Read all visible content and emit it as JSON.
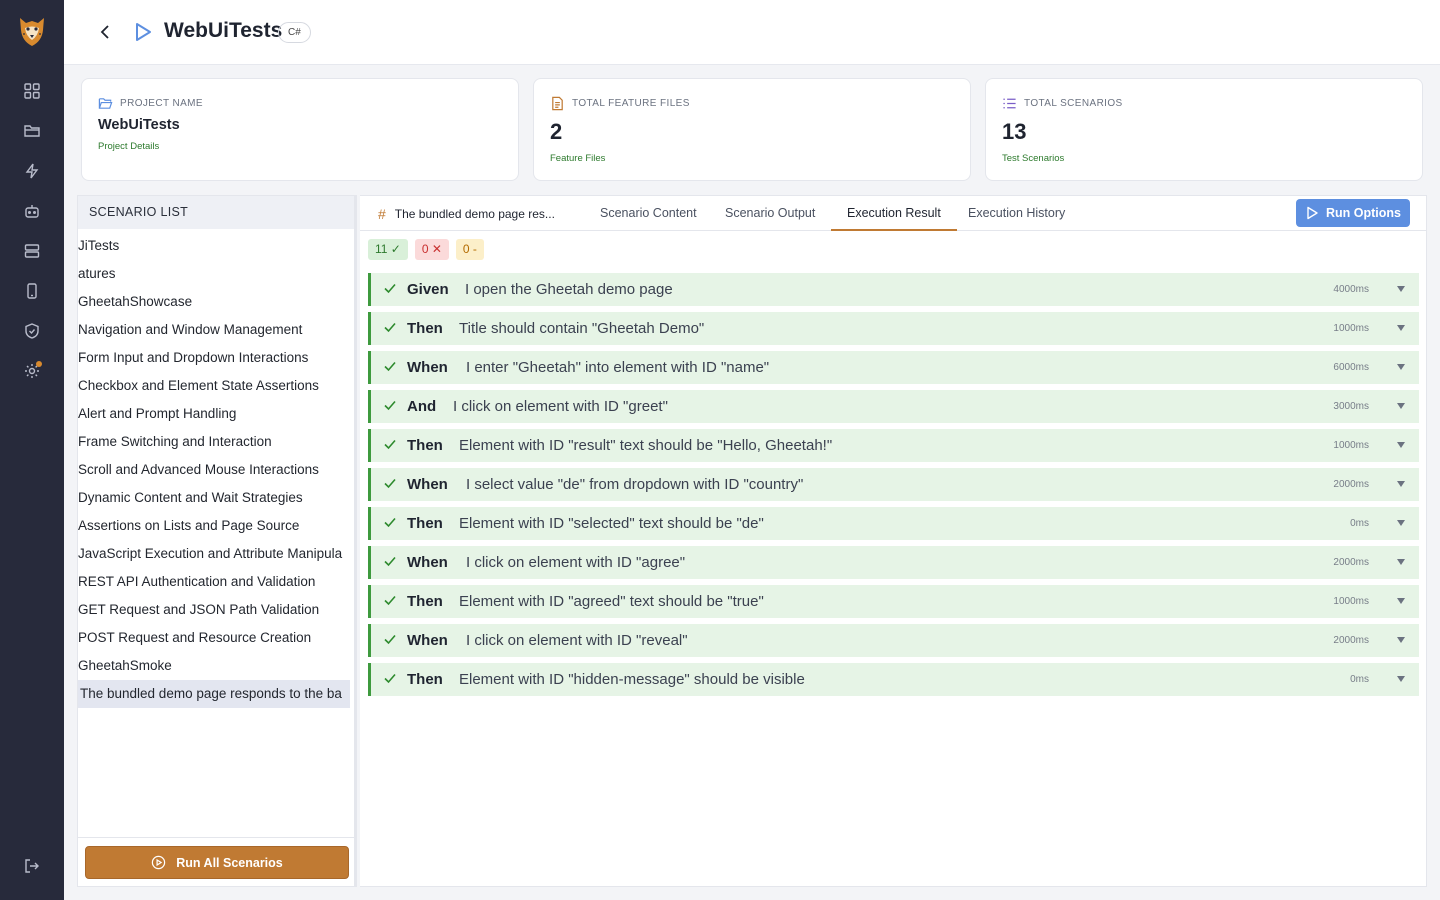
{
  "header": {
    "title": "WebUiTests",
    "language": "C#"
  },
  "cards": {
    "project": {
      "label": "PROJECT NAME",
      "value": "WebUiTests",
      "sub": "Project Details"
    },
    "features": {
      "label": "TOTAL FEATURE FILES",
      "value": "2",
      "sub": "Feature Files"
    },
    "scenarios": {
      "label": "TOTAL SCENARIOS",
      "value": "13",
      "sub": "Test Scenarios"
    }
  },
  "scenario_list": {
    "heading": "SCENARIO LIST",
    "items": [
      "JiTests",
      "atures",
      "GheetahShowcase",
      "Navigation and Window Management",
      "Form Input and Dropdown Interactions",
      "Checkbox and Element State Assertions",
      "Alert and Prompt Handling",
      "Frame Switching and Interaction",
      "Scroll and Advanced Mouse Interactions",
      "Dynamic Content and Wait Strategies",
      "Assertions on Lists and Page Source",
      "JavaScript Execution and Attribute Manipula",
      "REST API Authentication and Validation",
      "GET Request and JSON Path Validation",
      "POST Request and Resource Creation",
      "GheetahSmoke",
      "The bundled demo page responds to the ba"
    ],
    "run_all_label": "Run All Scenarios"
  },
  "main": {
    "feature_tab": "The bundled demo page res...",
    "tabs": [
      "Scenario Content",
      "Scenario Output",
      "Execution Result",
      "Execution History"
    ],
    "active_tab": "Execution Result",
    "run_options_label": "Run Options",
    "counts": {
      "passed": "11 ✓",
      "failed": "0 ✕",
      "skipped": "0 -"
    },
    "steps": [
      {
        "keyword": "Given",
        "text": "I open the Gheetah demo page",
        "duration": "4000ms"
      },
      {
        "keyword": "Then",
        "text": "Title should contain \"Gheetah Demo\"",
        "duration": "1000ms"
      },
      {
        "keyword": "When",
        "text": "I enter \"Gheetah\" into element with ID \"name\"",
        "duration": "6000ms"
      },
      {
        "keyword": "And",
        "text": "I click on element with ID \"greet\"",
        "duration": "3000ms"
      },
      {
        "keyword": "Then",
        "text": "Element with ID \"result\" text should be \"Hello, Gheetah!\"",
        "duration": "1000ms"
      },
      {
        "keyword": "When",
        "text": "I select value \"de\" from dropdown with ID \"country\"",
        "duration": "2000ms"
      },
      {
        "keyword": "Then",
        "text": "Element with ID \"selected\" text should be \"de\"",
        "duration": "0ms"
      },
      {
        "keyword": "When",
        "text": "I click on element with ID \"agree\"",
        "duration": "2000ms"
      },
      {
        "keyword": "Then",
        "text": "Element with ID \"agreed\" text should be \"true\"",
        "duration": "1000ms"
      },
      {
        "keyword": "When",
        "text": "I click on element with ID \"reveal\"",
        "duration": "2000ms"
      },
      {
        "keyword": "Then",
        "text": "Element with ID \"hidden-message\" should be visible",
        "duration": "0ms"
      }
    ]
  },
  "colors": {
    "rail": "#272a3b",
    "accent": "#c07a33",
    "primary_button": "#5d8fe0",
    "pass": "#3e9a3e"
  }
}
